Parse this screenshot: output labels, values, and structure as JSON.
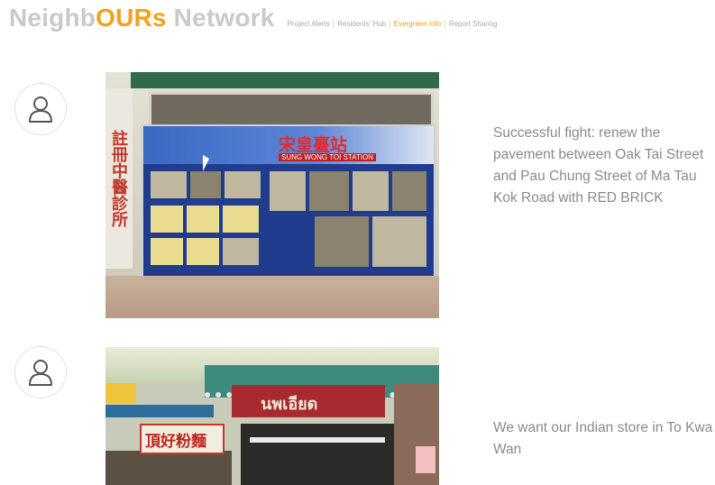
{
  "header": {
    "brand": {
      "part1": "Neighb",
      "accent": "OURs",
      "part2": " Network"
    },
    "nav": [
      {
        "label": "Project Alerts",
        "active": false
      },
      {
        "label": "Residents' Hub",
        "active": false
      },
      {
        "label": "Evergreen Info",
        "active": true
      },
      {
        "label": "Report Sharing",
        "active": false
      }
    ],
    "separator": "|"
  },
  "colors": {
    "accent": "#f3a11c",
    "brand_grey": "#c9c9c9",
    "text_grey": "#8a8a8a"
  },
  "posts": [
    {
      "avatar_icon": "user-icon",
      "text": "Successful fight: renew the pavement between Oak Tai Street and Pau Chung Street of Ma Tau Kok Road with RED BRICK",
      "photo": {
        "sign_vertical": "註冊中醫診所",
        "board_title": "宋皇臺站",
        "board_sub": "SUNG WONG TOI STATION"
      }
    },
    {
      "avatar_icon": "user-icon",
      "text": "We want our Indian store in To Kwa Wan",
      "photo": {
        "store_sign": "頂好粉麵",
        "red_sign": "นพเอียด"
      }
    }
  ]
}
